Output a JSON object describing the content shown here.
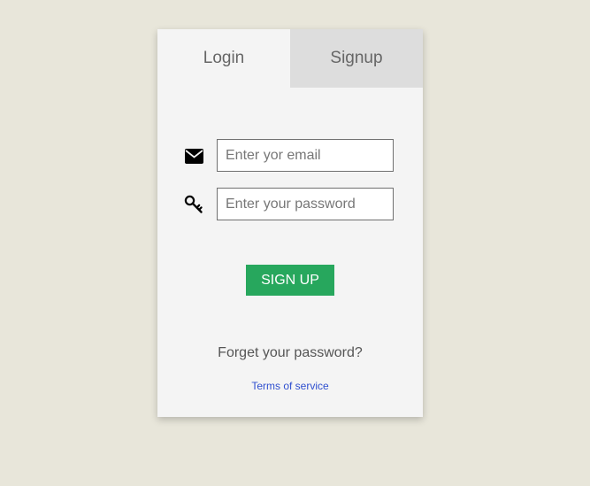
{
  "tabs": {
    "login_label": "Login",
    "signup_label": "Signup",
    "active": "login"
  },
  "form": {
    "email": {
      "icon": "envelope-icon",
      "placeholder": "Enter yor email",
      "value": ""
    },
    "password": {
      "icon": "key-icon",
      "placeholder": "Enter your password",
      "value": ""
    },
    "submit_label": "SIGN UP"
  },
  "links": {
    "forgot_password": "Forget your password?",
    "terms": "Terms of service"
  },
  "colors": {
    "background": "#e8e6da",
    "card": "#f4f4f4",
    "inactive_tab": "#dddddd",
    "button": "#27a75d",
    "link": "#2f4fcf"
  }
}
